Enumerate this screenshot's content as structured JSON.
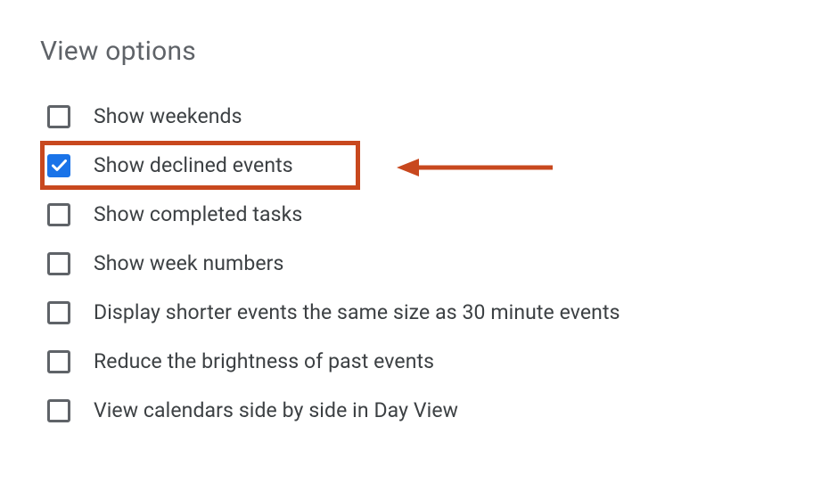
{
  "section_title": "View options",
  "options": [
    {
      "label": "Show weekends",
      "checked": false,
      "highlighted": false
    },
    {
      "label": "Show declined events",
      "checked": true,
      "highlighted": true
    },
    {
      "label": "Show completed tasks",
      "checked": false,
      "highlighted": false
    },
    {
      "label": "Show week numbers",
      "checked": false,
      "highlighted": false
    },
    {
      "label": "Display shorter events the same size as 30 minute events",
      "checked": false,
      "highlighted": false
    },
    {
      "label": "Reduce the brightness of past events",
      "checked": false,
      "highlighted": false
    },
    {
      "label": "View calendars side by side in Day View",
      "checked": false,
      "highlighted": false
    }
  ],
  "annotation": {
    "highlight_color": "#c8481e",
    "arrow_color": "#c8481e"
  }
}
